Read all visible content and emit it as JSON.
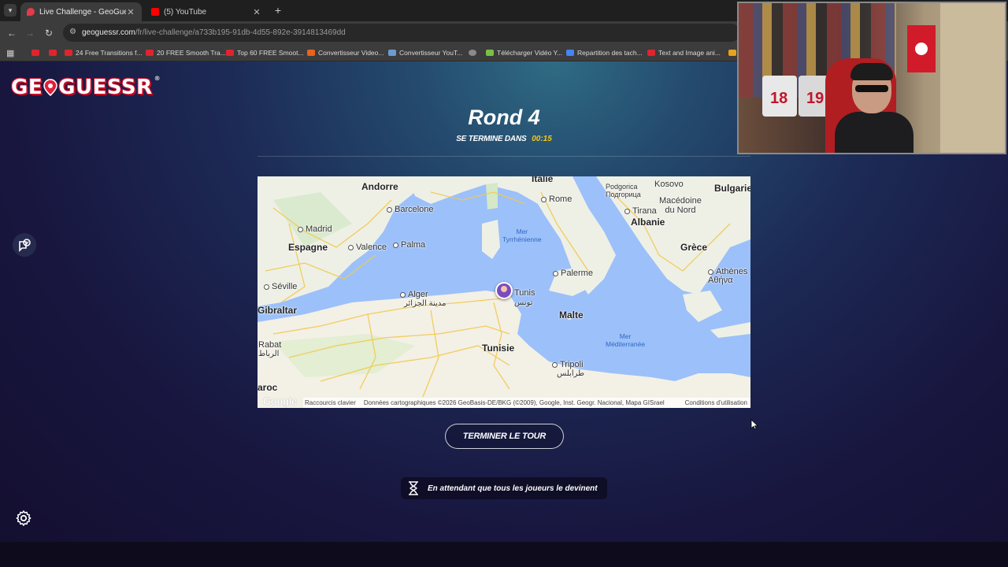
{
  "browser": {
    "tabs": [
      {
        "title": "Live Challenge - GeoGuessr",
        "active": true
      },
      {
        "title": "(5) YouTube",
        "active": false
      }
    ],
    "url_domain": "geoguessr.com",
    "url_path": "/fr/live-challenge/a733b195-91db-4d55-892e-3914813469dd",
    "bookmarks": [
      "24 Free Transitions f...",
      "20 FREE Smooth Tra...",
      "Top 60 FREE Smoot...",
      "Convertisseur Video...",
      "Convertisseur YouT...",
      "Télécharger Vidéo Y...",
      "Repartition des tach...",
      "Text and Image ani..."
    ]
  },
  "header": {
    "logo_text_pre": "GE",
    "logo_text_post": "GUESSR",
    "logo_reg": "®",
    "round_title": "Rond 4",
    "timer_label": "SE TERMINE DANS",
    "timer_value": "00:15"
  },
  "map": {
    "labels": {
      "andorre": "Andorre",
      "italie": "Italie",
      "kosovo": "Kosovo",
      "bulgarie": "Bulgarie",
      "podgorica": "Podgorica\nПодгорица",
      "macedoine": "Macédoine\ndu Nord",
      "tirana": "Tirana",
      "albanie": "Albanie",
      "rome": "Rome",
      "barcelone": "Barcelone",
      "madrid": "Madrid",
      "espagne": "Espagne",
      "valence": "Valence",
      "palma": "Palma",
      "mer_tyrrh": "Mer\nTyrrhénienne",
      "grece": "Grèce",
      "athenes": "Athènes\nΑθήνα",
      "palerme": "Palerme",
      "seville": "Séville",
      "alger": "Alger",
      "alger_ar": "مدينة الجزائر",
      "tunis": "Tunis",
      "tunis_ar": "تونس",
      "gibraltar": "Gibraltar",
      "malte": "Malte",
      "mer_med": "Mer\nMéditerranée",
      "rabat": "Rabat",
      "rabat_ar": "الرباط",
      "tunisie": "Tunisie",
      "tripoli": "Tripoli",
      "tripoli_ar": "طرابلس",
      "maroc": "aroc"
    },
    "google": "Google",
    "shortcuts": "Raccourcis clavier",
    "data_credit": "Données cartographiques ©2026 GeoBasis-DE/BKG (©2009), Google, Inst. Geogr. Nacional, Mapa GISrael",
    "terms": "Conditions d'utilisation"
  },
  "actions": {
    "end_round": "TERMINER LE TOUR",
    "waiting": "En attendant que tous les joueurs le devinent"
  },
  "webcam": {
    "jersey_numbers": [
      "18",
      "19"
    ]
  },
  "colors": {
    "accent_yellow": "#f5c518",
    "logo_red": "#c40e2a",
    "sea": "#9cc0f9",
    "land": "#eef0e6",
    "roads": "#f2c94c"
  }
}
